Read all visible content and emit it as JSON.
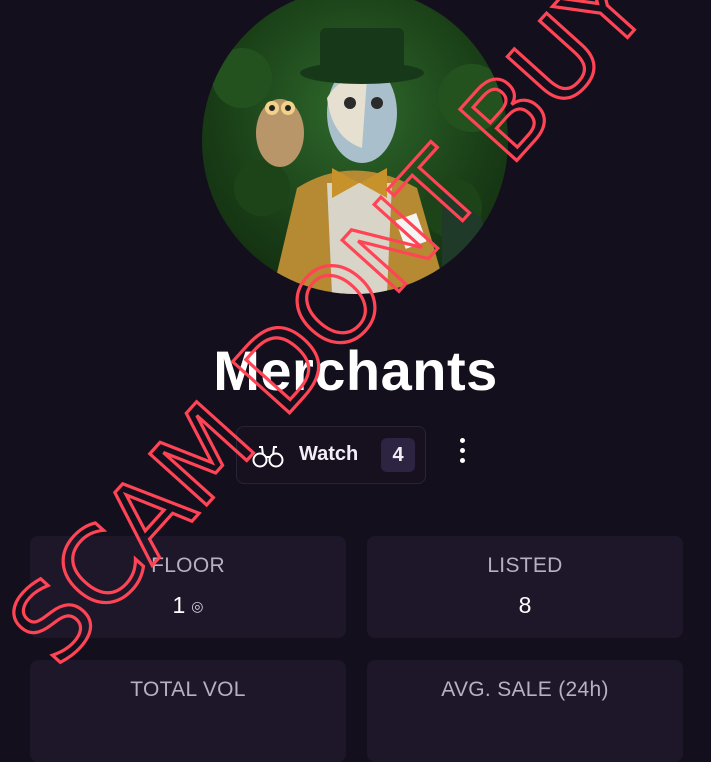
{
  "collection": {
    "name": "Merchants",
    "avatar_icon": "merchant-with-owl-avatar"
  },
  "actions": {
    "watch_label": "Watch",
    "watch_count": "4",
    "watch_icon": "binoculars-icon",
    "more_icon": "more-vertical-icon"
  },
  "stats": {
    "floor": {
      "label": "FLOOR",
      "value": "1",
      "currency_icon": "solana-icon"
    },
    "listed": {
      "label": "LISTED",
      "value": "8"
    },
    "total_vol": {
      "label": "TOTAL VOL",
      "value": ""
    },
    "avg_sale": {
      "label": "AVG. SALE (24h)",
      "value": ""
    }
  },
  "overlay": {
    "text": "SCAM DONT BUY",
    "color": "#ff4456"
  },
  "colors": {
    "background": "#140f1c",
    "card": "#1e1729",
    "badge": "#2c2440"
  }
}
